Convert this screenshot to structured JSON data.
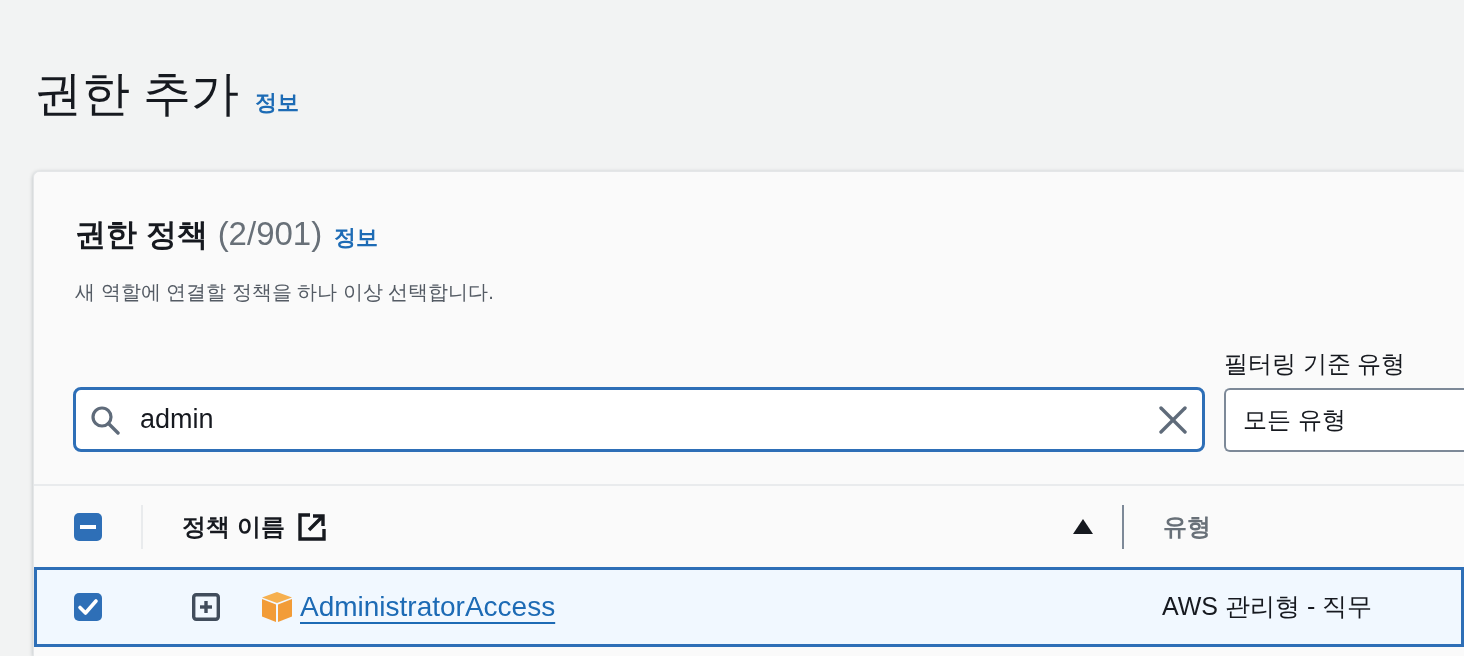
{
  "page": {
    "title": "권한 추가",
    "info_link": "정보"
  },
  "policies_panel": {
    "title": "권한 정책",
    "count": "(2/901)",
    "info_link": "정보",
    "description": "새 역할에 연결할 정책을 하나 이상 선택합니다.",
    "search": {
      "value": "admin"
    },
    "filter": {
      "label": "필터링 기준 유형",
      "value": "모든 유형"
    },
    "table": {
      "select_all": {
        "checked": true,
        "indeterminate": true
      },
      "columns": [
        {
          "label": "정책 이름",
          "external_link": true,
          "sorted": true,
          "descending": false
        },
        {
          "label": "유형",
          "sorted": false
        }
      ],
      "rows": [
        {
          "selected": true,
          "expanded": false,
          "name": "AdministratorAccess",
          "type": "AWS 관리형 - 직무"
        }
      ]
    }
  }
}
